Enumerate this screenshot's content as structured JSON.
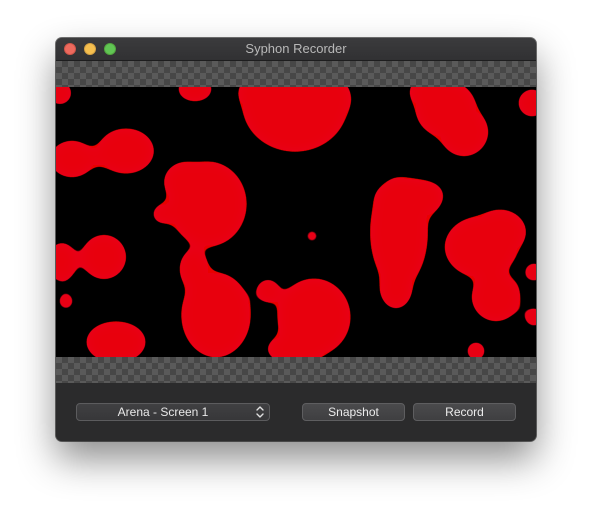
{
  "window": {
    "title": "Syphon Recorder"
  },
  "source_select": {
    "selected": "Arena - Screen 1",
    "icon": "updown-chevron-icon"
  },
  "buttons": {
    "snapshot": "Snapshot",
    "record": "Record"
  },
  "preview": {
    "background_color": "#000000",
    "blob_color": "#e8000d",
    "transparent_pattern": "checkerboard"
  },
  "colors": {
    "close": "#ed6a5e",
    "minimize": "#f5bf4f",
    "zoom": "#61c554"
  }
}
